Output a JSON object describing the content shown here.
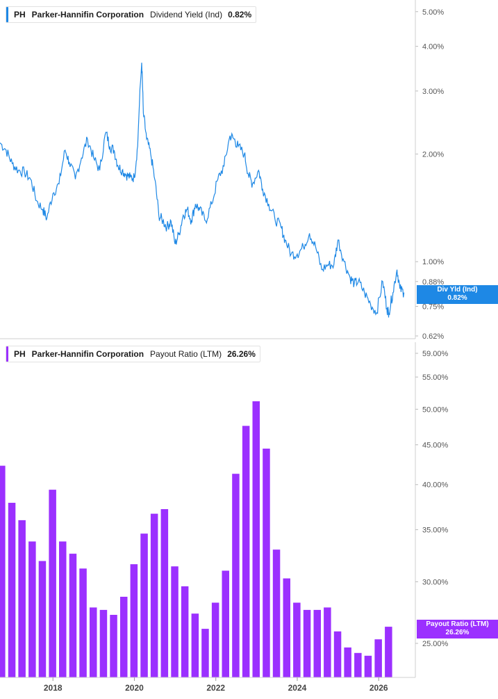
{
  "colors": {
    "yield": "#1e88e5",
    "payout": "#9b30ff"
  },
  "top_legend": {
    "ticker": "PH",
    "company": "Parker-Hannifin Corporation",
    "metric": "Dividend Yield (Ind)",
    "value": "0.82%"
  },
  "bottom_legend": {
    "ticker": "PH",
    "company": "Parker-Hannifin Corporation",
    "metric": "Payout Ratio (LTM)",
    "value": "26.26%"
  },
  "top_flag": {
    "line1": "Div Yld (Ind)",
    "line2": "0.82%"
  },
  "bottom_flag": {
    "line1": "Payout Ratio (LTM)",
    "line2": "26.26%"
  },
  "chart_data": [
    {
      "type": "line",
      "series": [
        {
          "name": "Dividend Yield (Ind)"
        }
      ],
      "y_scale": "log",
      "ylim": [
        0.62,
        5.2
      ],
      "xlim": [
        2016.7,
        2026.9
      ],
      "yticks": [
        {
          "v": 5.0,
          "label": "5.00%"
        },
        {
          "v": 4.0,
          "label": "4.00%"
        },
        {
          "v": 3.0,
          "label": "3.00%"
        },
        {
          "v": 2.0,
          "label": "2.00%"
        },
        {
          "v": 1.0,
          "label": "1.00%"
        },
        {
          "v": 0.88,
          "label": "0.88%"
        },
        {
          "v": 0.75,
          "label": "0.75%"
        },
        {
          "v": 0.62,
          "label": "0.62%"
        }
      ],
      "x": [
        2016.7,
        2016.85,
        2017.0,
        2017.15,
        2017.3,
        2017.45,
        2017.6,
        2017.75,
        2017.85,
        2018.0,
        2018.15,
        2018.3,
        2018.4,
        2018.55,
        2018.7,
        2018.85,
        2019.0,
        2019.15,
        2019.3,
        2019.4,
        2019.5,
        2019.6,
        2019.7,
        2019.8,
        2019.9,
        2020.0,
        2020.08,
        2020.18,
        2020.22,
        2020.3,
        2020.4,
        2020.5,
        2020.6,
        2020.7,
        2020.8,
        2020.9,
        2021.0,
        2021.1,
        2021.2,
        2021.3,
        2021.4,
        2021.5,
        2021.6,
        2021.75,
        2021.9,
        2022.05,
        2022.2,
        2022.35,
        2022.45,
        2022.55,
        2022.7,
        2022.8,
        2022.9,
        2023.05,
        2023.15,
        2023.3,
        2023.45,
        2023.6,
        2023.7,
        2023.85,
        2024.0,
        2024.15,
        2024.3,
        2024.45,
        2024.6,
        2024.75,
        2024.9,
        2025.0,
        2025.15,
        2025.3,
        2025.4,
        2025.5,
        2025.65,
        2025.8,
        2025.95,
        2026.1,
        2026.2,
        2026.25,
        2026.35,
        2026.45,
        2026.52,
        2026.62
      ],
      "y": [
        2.15,
        2.05,
        1.88,
        1.8,
        1.78,
        1.7,
        1.48,
        1.4,
        1.32,
        1.55,
        1.65,
        2.05,
        1.9,
        1.7,
        1.95,
        2.2,
        1.95,
        1.8,
        2.3,
        2.1,
        2.05,
        1.85,
        1.8,
        1.75,
        1.72,
        1.72,
        2.1,
        3.6,
        2.6,
        2.2,
        2.0,
        1.7,
        1.35,
        1.3,
        1.25,
        1.3,
        1.12,
        1.2,
        1.35,
        1.4,
        1.3,
        1.45,
        1.4,
        1.3,
        1.45,
        1.7,
        1.85,
        2.25,
        2.2,
        2.1,
        2.0,
        1.75,
        1.65,
        1.8,
        1.6,
        1.45,
        1.32,
        1.25,
        1.15,
        1.05,
        1.05,
        1.1,
        1.2,
        1.1,
        0.95,
        0.98,
        0.98,
        1.15,
        1.0,
        0.9,
        0.87,
        0.88,
        0.82,
        0.76,
        0.72,
        0.88,
        0.74,
        0.72,
        0.82,
        0.95,
        0.84,
        0.82
      ]
    },
    {
      "type": "bar",
      "series": [
        {
          "name": "Payout Ratio (LTM)"
        }
      ],
      "y_scale": "log",
      "ylim": [
        22.6,
        59.0
      ],
      "yticks": [
        {
          "v": 59,
          "label": "59.00%"
        },
        {
          "v": 55,
          "label": "55.00%"
        },
        {
          "v": 50,
          "label": "50.00%"
        },
        {
          "v": 45,
          "label": "45.00%"
        },
        {
          "v": 40,
          "label": "40.00%"
        },
        {
          "v": 35,
          "label": "35.00%"
        },
        {
          "v": 30,
          "label": "30.00%"
        },
        {
          "v": 25,
          "label": "25.00%"
        }
      ],
      "xticks": [
        "2018",
        "2020",
        "2022",
        "2024",
        "2026"
      ],
      "x": [
        2016.74,
        2016.99,
        2017.24,
        2017.49,
        2017.74,
        2017.99,
        2018.24,
        2018.49,
        2018.74,
        2018.99,
        2019.24,
        2019.49,
        2019.74,
        2019.99,
        2020.24,
        2020.49,
        2020.74,
        2020.99,
        2021.24,
        2021.49,
        2021.74,
        2021.99,
        2022.24,
        2022.49,
        2022.74,
        2022.99,
        2023.24,
        2023.49,
        2023.74,
        2023.99,
        2024.24,
        2024.49,
        2024.74,
        2024.99,
        2025.24,
        2025.49,
        2025.74,
        2025.99,
        2026.24
      ],
      "values": [
        42.3,
        37.9,
        36.0,
        33.8,
        31.9,
        39.4,
        33.8,
        32.6,
        31.2,
        27.8,
        27.6,
        27.2,
        28.7,
        31.6,
        34.6,
        36.7,
        37.2,
        31.4,
        29.6,
        27.3,
        26.1,
        28.2,
        31.0,
        41.3,
        47.6,
        51.2,
        44.5,
        33.0,
        30.3,
        28.2,
        27.6,
        27.6,
        27.8,
        25.9,
        24.7,
        24.3,
        24.1,
        25.3,
        26.26
      ]
    }
  ]
}
